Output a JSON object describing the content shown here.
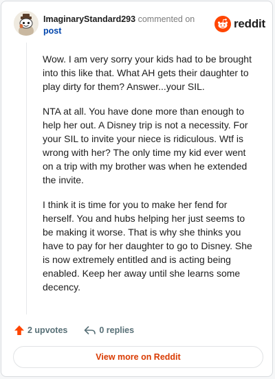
{
  "comment": {
    "author": "ImaginaryStandard293",
    "verb": "commented on",
    "target": "post",
    "paragraphs": [
      "Wow. I am very sorry your kids had to be brought into this like that. What AH gets their daughter to play dirty for them? Answer...your SIL.",
      "NTA at all. You have done more than enough to help her out. A Disney trip is not a necessity. For your SIL to invite your niece is ridiculous. Wtf is wrong with her? The only time my kid ever went on a trip with my brother was when he extended the invite.",
      "I think it is time for you to make her fend for herself. You and hubs helping her just seems to be making it worse. That is why she thinks you have to pay for her daughter to go to Disney. She is now extremely entitled and is acting being enabled. Keep her away until she learns some decency."
    ]
  },
  "brand": {
    "name": "reddit",
    "color": "#ff4500"
  },
  "actions": {
    "upvotes": "2 upvotes",
    "replies": "0 replies"
  },
  "view_more_label": "View more on Reddit",
  "icons": {
    "avatar": "snoo-avatar-icon",
    "upvote": "upvote-arrow-icon",
    "reply": "reply-icon",
    "brand": "reddit-logo-icon"
  }
}
